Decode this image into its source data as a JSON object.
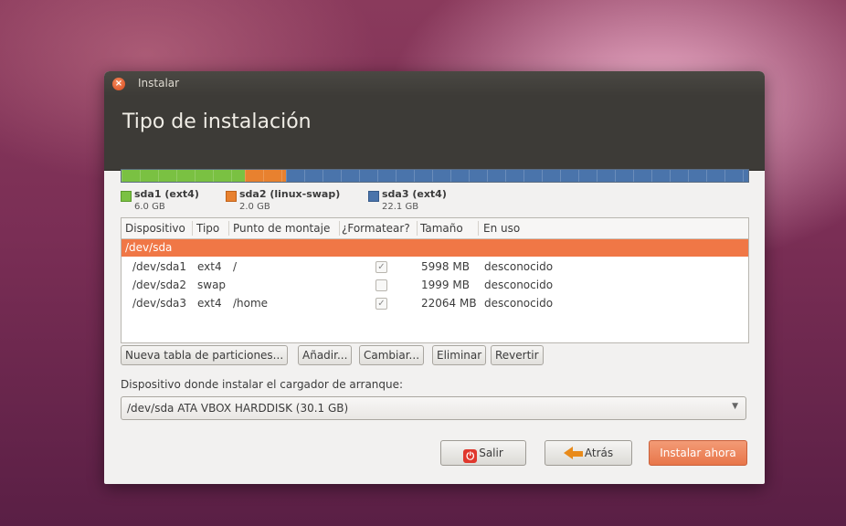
{
  "window": {
    "title": "Instalar"
  },
  "page": {
    "title": "Tipo de instalación"
  },
  "partitions": [
    {
      "name": "sda1 (ext4)",
      "size": "6.0 GB",
      "color": "#7ac142"
    },
    {
      "name": "sda2 (linux-swap)",
      "size": "2.0 GB",
      "color": "#e8812f"
    },
    {
      "name": "sda3 (ext4)",
      "size": "22.1 GB",
      "color": "#4a74ab"
    }
  ],
  "table": {
    "columns": [
      "Dispositivo",
      "Tipo",
      "Punto de montaje",
      "¿Formatear?",
      "Tamaño",
      "En uso"
    ],
    "selected_device": "/dev/sda",
    "rows": [
      {
        "device": "/dev/sda1",
        "type": "ext4",
        "mount": "/",
        "format": true,
        "size": "5998 MB",
        "used": "desconocido"
      },
      {
        "device": "/dev/sda2",
        "type": "swap",
        "mount": "",
        "format": false,
        "size": "1999 MB",
        "used": "desconocido"
      },
      {
        "device": "/dev/sda3",
        "type": "ext4",
        "mount": "/home",
        "format": true,
        "size": "22064 MB",
        "used": "desconocido"
      }
    ]
  },
  "buttons": {
    "new_table": "Nueva tabla de particiones...",
    "add": "Añadir...",
    "change": "Cambiar...",
    "delete": "Eliminar",
    "revert": "Revertir",
    "quit": "Salir",
    "back": "Atrás",
    "install": "Instalar ahora"
  },
  "bootloader": {
    "label": "Dispositivo donde instalar el cargador de arranque:",
    "selected": "/dev/sda   ATA VBOX HARDDISK (30.1 GB)"
  }
}
